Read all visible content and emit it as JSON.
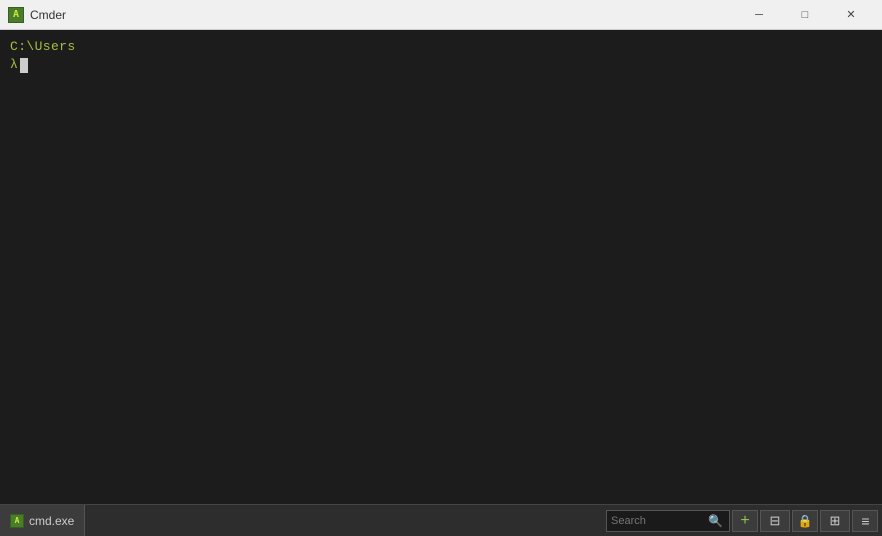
{
  "titleBar": {
    "appIconLabel": "A",
    "title": "Cmder",
    "minimizeLabel": "─",
    "maximizeLabel": "□",
    "closeLabel": "✕"
  },
  "terminal": {
    "line1": "C:\\Users",
    "promptSymbol": "λ",
    "cursorVisible": true
  },
  "statusBar": {
    "tabIcon": "A",
    "tabLabel": "cmd.exe",
    "searchPlaceholder": "Search",
    "searchValue": "",
    "addTabIcon": "+",
    "splitViewIcon": "⊞",
    "lockIcon": "🔒",
    "menuIcon": "≡"
  },
  "colors": {
    "terminalBg": "#1c1c1c",
    "terminalText": "#a0c040",
    "titleBarBg": "#f0f0f0",
    "statusBarBg": "#2d2d2d"
  }
}
